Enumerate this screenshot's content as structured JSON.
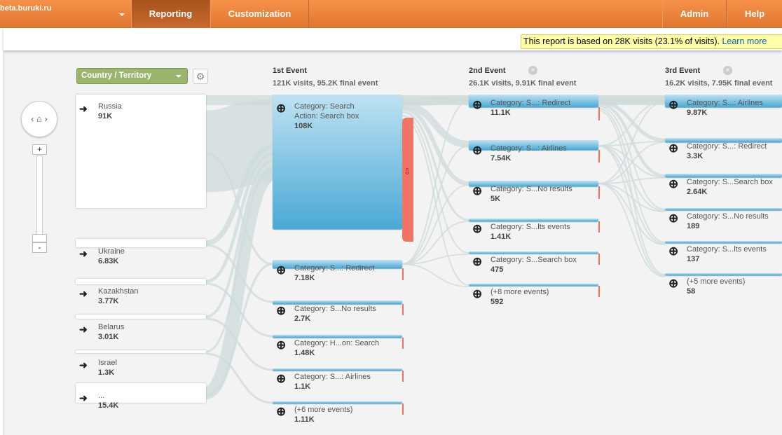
{
  "header": {
    "site": "beta.buruki.ru",
    "tabs": [
      "Reporting",
      "Customization"
    ],
    "right": [
      "Admin",
      "Help"
    ]
  },
  "notice": {
    "text": "This report is based on 28K visits (23.1% of visits). ",
    "link": "Learn more"
  },
  "dimension": {
    "label": "Country / Territory"
  },
  "columns": [
    {
      "title": "1st Event",
      "stats": "121K visits, 95.2K final event"
    },
    {
      "title": "2nd Event",
      "stats": "26.1K visits, 9.91K final event"
    },
    {
      "title": "3rd Event",
      "stats": "16.2K visits, 7.95K final event"
    }
  ],
  "countries": [
    {
      "name": "Russia",
      "value": "91K"
    },
    {
      "name": "Ukraine",
      "value": "6.83K"
    },
    {
      "name": "Kazakhstan",
      "value": "3.77K"
    },
    {
      "name": "Belarus",
      "value": "3.01K"
    },
    {
      "name": "Israel",
      "value": "1.3K"
    },
    {
      "name": "...",
      "value": "15.4K"
    }
  ],
  "event1": [
    {
      "name": "Category: Search\nAction: Search box",
      "value": "108K"
    },
    {
      "name": "Category: S...: Redirect",
      "value": "7.18K"
    },
    {
      "name": "Category: S...No results",
      "value": "2.7K"
    },
    {
      "name": "Category: H...on: Search",
      "value": "1.48K"
    },
    {
      "name": "Category: S...: Airlines",
      "value": "1.1K"
    },
    {
      "name": "(+6 more events)",
      "value": "1.11K"
    }
  ],
  "event2": [
    {
      "name": "Category: S...: Redirect",
      "value": "11.1K"
    },
    {
      "name": "Category: S...: Airlines",
      "value": "7.54K"
    },
    {
      "name": "Category: S...No results",
      "value": "5K"
    },
    {
      "name": "Category: S...lts events",
      "value": "1.41K"
    },
    {
      "name": "Category: S...Search box",
      "value": "475"
    },
    {
      "name": "(+8 more events)",
      "value": "592"
    }
  ],
  "event3": [
    {
      "name": "Category: S...: Airlines",
      "value": "9.87K"
    },
    {
      "name": "Category: S...: Redirect",
      "value": "3.3K"
    },
    {
      "name": "Category: S...Search box",
      "value": "2.64K"
    },
    {
      "name": "Category: S...No results",
      "value": "189"
    },
    {
      "name": "Category: S...lts events",
      "value": "137"
    },
    {
      "name": "(+5 more events)",
      "value": "58"
    }
  ],
  "zoom": {
    "plus": "+",
    "minus": "-"
  },
  "colors": {
    "header": "#f08a40",
    "node": "#4aa9d6",
    "dropoff": "#f07060",
    "dimension": "#9cb56c"
  }
}
